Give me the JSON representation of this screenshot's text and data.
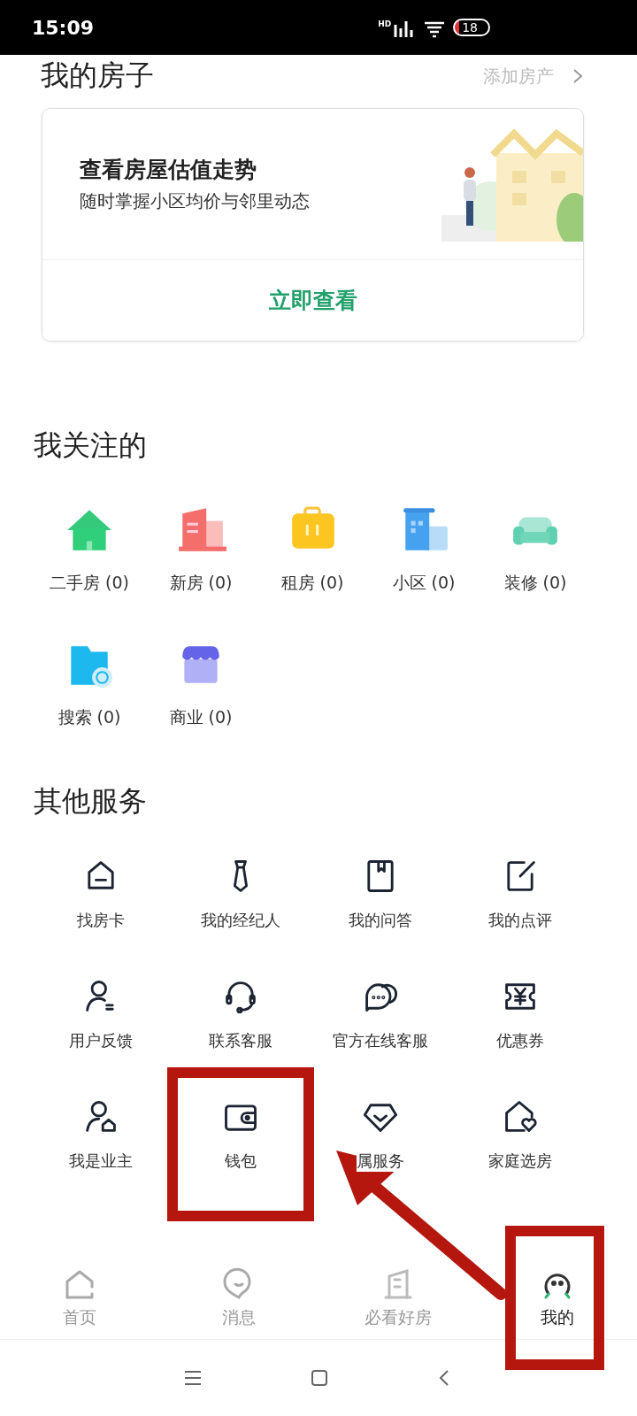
{
  "status_bar": {
    "time": "15:09",
    "network": "HD",
    "battery": "18"
  },
  "header": {
    "title": "我的房子",
    "action": "添加房产"
  },
  "valuation_card": {
    "title": "查看房屋估值走势",
    "subtitle": "随时掌握小区均价与邻里动态",
    "button": "立即查看"
  },
  "following": {
    "title": "我关注的",
    "items": [
      {
        "label": "二手房 (0)"
      },
      {
        "label": "新房 (0)"
      },
      {
        "label": "租房 (0)"
      },
      {
        "label": "小区 (0)"
      },
      {
        "label": "装修 (0)"
      },
      {
        "label": "搜索 (0)"
      },
      {
        "label": "商业 (0)"
      }
    ]
  },
  "services": {
    "title": "其他服务",
    "items": [
      {
        "label": "找房卡",
        "highlighted": false
      },
      {
        "label": "我的经纪人",
        "highlighted": false
      },
      {
        "label": "我的问答",
        "highlighted": false
      },
      {
        "label": "我的点评",
        "highlighted": false
      },
      {
        "label": "用户反馈",
        "highlighted": false
      },
      {
        "label": "联系客服",
        "highlighted": false
      },
      {
        "label": "官方在线客服",
        "highlighted": false
      },
      {
        "label": "优惠券",
        "highlighted": false
      },
      {
        "label": "我是业主",
        "highlighted": false
      },
      {
        "label": "钱包",
        "highlighted": true
      },
      {
        "label": "属服务",
        "highlighted": false
      },
      {
        "label": "家庭选房",
        "highlighted": false
      }
    ]
  },
  "tab_bar": [
    {
      "label": "首页",
      "selected": false,
      "highlighted": false
    },
    {
      "label": "消息",
      "selected": false,
      "highlighted": false
    },
    {
      "label": "必看好房",
      "selected": false,
      "highlighted": false
    },
    {
      "label": "我的",
      "selected": true,
      "highlighted": true
    }
  ],
  "arrow": {
    "shown": true
  }
}
